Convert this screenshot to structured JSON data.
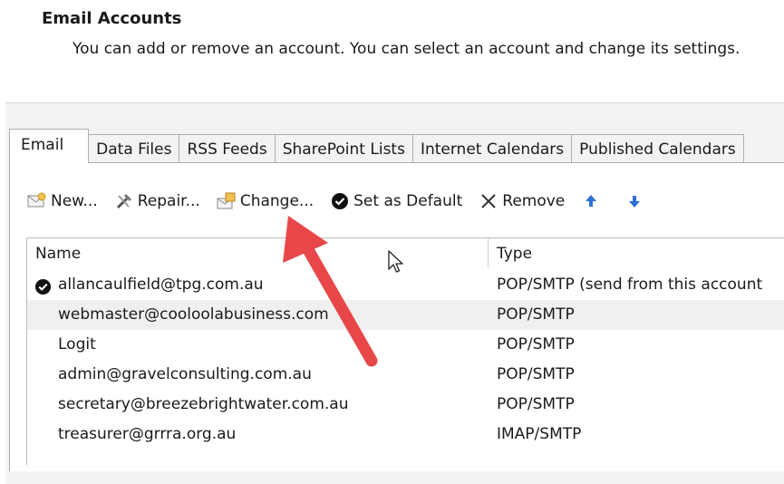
{
  "header": {
    "title": "Email Accounts",
    "description": "You can add or remove an account. You can select an account and change its settings."
  },
  "tabs": [
    {
      "label": "Email",
      "active": true
    },
    {
      "label": "Data Files"
    },
    {
      "label": "RSS Feeds"
    },
    {
      "label": "SharePoint Lists"
    },
    {
      "label": "Internet Calendars"
    },
    {
      "label": "Published Calendars"
    }
  ],
  "toolbar": {
    "new_label": "New...",
    "repair_label": "Repair...",
    "change_label": "Change...",
    "set_default_label": "Set as Default",
    "remove_label": "Remove"
  },
  "list": {
    "col_name": "Name",
    "col_type": "Type",
    "rows": [
      {
        "name": "allancaulfield@tpg.com.au",
        "type": "POP/SMTP (send from this account",
        "default": true
      },
      {
        "name": "webmaster@cooloolabusiness.com",
        "type": "POP/SMTP",
        "selected": true
      },
      {
        "name": "Logit",
        "type": "POP/SMTP"
      },
      {
        "name": "admin@gravelconsulting.com.au",
        "type": "POP/SMTP"
      },
      {
        "name": "secretary@breezebrightwater.com.au",
        "type": "POP/SMTP"
      },
      {
        "name": "treasurer@grrra.org.au",
        "type": "IMAP/SMTP"
      }
    ]
  },
  "colors": {
    "annotation_arrow": "#e8474a",
    "arrow_icon_blue": "#2f6fd6"
  }
}
